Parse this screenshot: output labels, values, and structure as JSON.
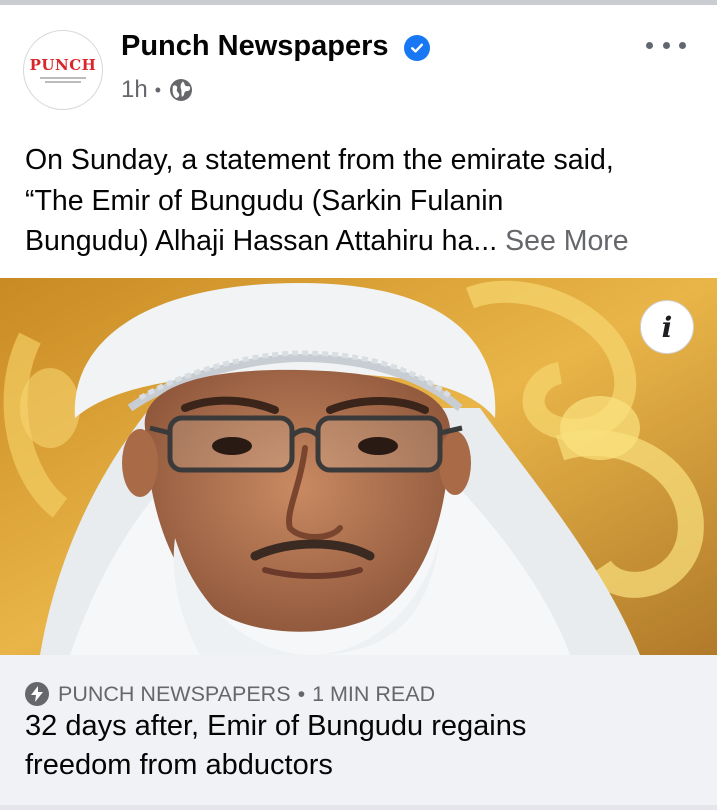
{
  "post": {
    "page_name": "Punch Newspapers",
    "avatar_text": "PUNCH",
    "time": "1h",
    "separator": "•",
    "privacy_icon": "globe-icon",
    "verified_icon": "verified-badge-icon",
    "menu_icon": "more-options-icon",
    "text_line1": "On Sunday, a statement from the emirate said,",
    "text_line2": "“The Emir of Bungudu (Sarkin Fulanin",
    "text_line3": "Bungudu) Alhaji Hassan Attahiru ha...",
    "see_more": "See More"
  },
  "image": {
    "info_label": "i"
  },
  "link_preview": {
    "source": "PUNCH NEWSPAPERS",
    "separator": "•",
    "read_time": "1 MIN READ",
    "title_line1": "32 days after, Emir of Bungudu regains",
    "title_line2": "freedom from abductors",
    "source_icon": "lightning-bolt-icon"
  },
  "colors": {
    "verified_blue": "#1877f2",
    "punch_red": "#d9262c",
    "secondary_text": "#65676b",
    "link_box_bg": "#f0f2f5"
  }
}
